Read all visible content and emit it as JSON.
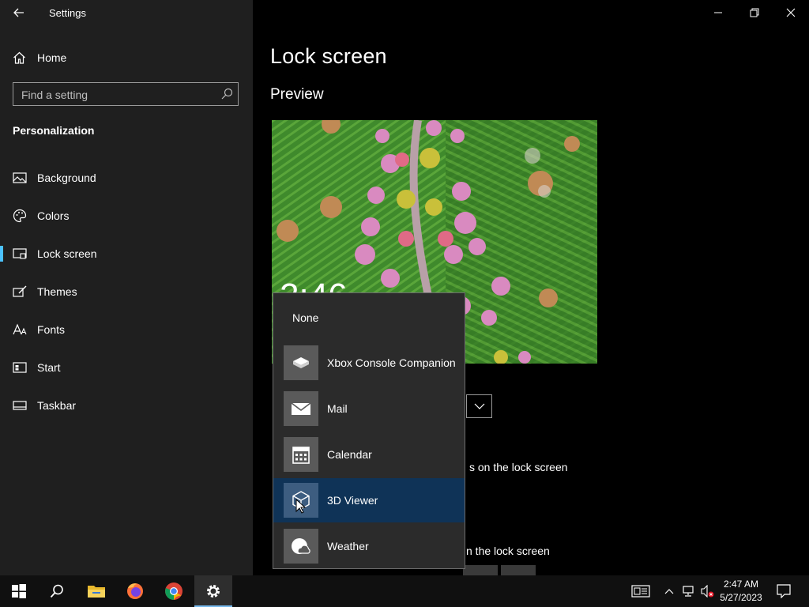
{
  "window": {
    "title": "Settings"
  },
  "sidebar": {
    "home_label": "Home",
    "search_placeholder": "Find a setting",
    "section_title": "Personalization",
    "items": [
      {
        "label": "Background",
        "icon": "image-icon"
      },
      {
        "label": "Colors",
        "icon": "palette-icon"
      },
      {
        "label": "Lock screen",
        "icon": "lock-screen-icon",
        "active": true
      },
      {
        "label": "Themes",
        "icon": "brush-icon"
      },
      {
        "label": "Fonts",
        "icon": "font-icon"
      },
      {
        "label": "Start",
        "icon": "start-icon"
      },
      {
        "label": "Taskbar",
        "icon": "taskbar-icon"
      }
    ]
  },
  "main": {
    "title": "Lock screen",
    "preview_heading": "Preview",
    "clock_partial": "2:46",
    "status_text_1": "s on the lock screen",
    "status_text_2": "n the lock screen"
  },
  "app_picker": {
    "none_label": "None",
    "options": [
      {
        "label": "Xbox Console Companion",
        "icon": "xbox-icon"
      },
      {
        "label": "Mail",
        "icon": "mail-icon"
      },
      {
        "label": "Calendar",
        "icon": "calendar-icon"
      },
      {
        "label": "3D Viewer",
        "icon": "cube-icon",
        "selected": true
      },
      {
        "label": "Weather",
        "icon": "weather-icon"
      }
    ]
  },
  "taskbar": {
    "time": "2:47 AM",
    "date": "5/27/2023",
    "apps": [
      "start-icon",
      "search-icon",
      "file-explorer-icon",
      "firefox-icon",
      "chrome-icon",
      "settings-icon"
    ]
  },
  "colors": {
    "accent": "#4cc2ff",
    "selection": "#0f3357",
    "sidebar_bg": "#1f1f1f"
  }
}
